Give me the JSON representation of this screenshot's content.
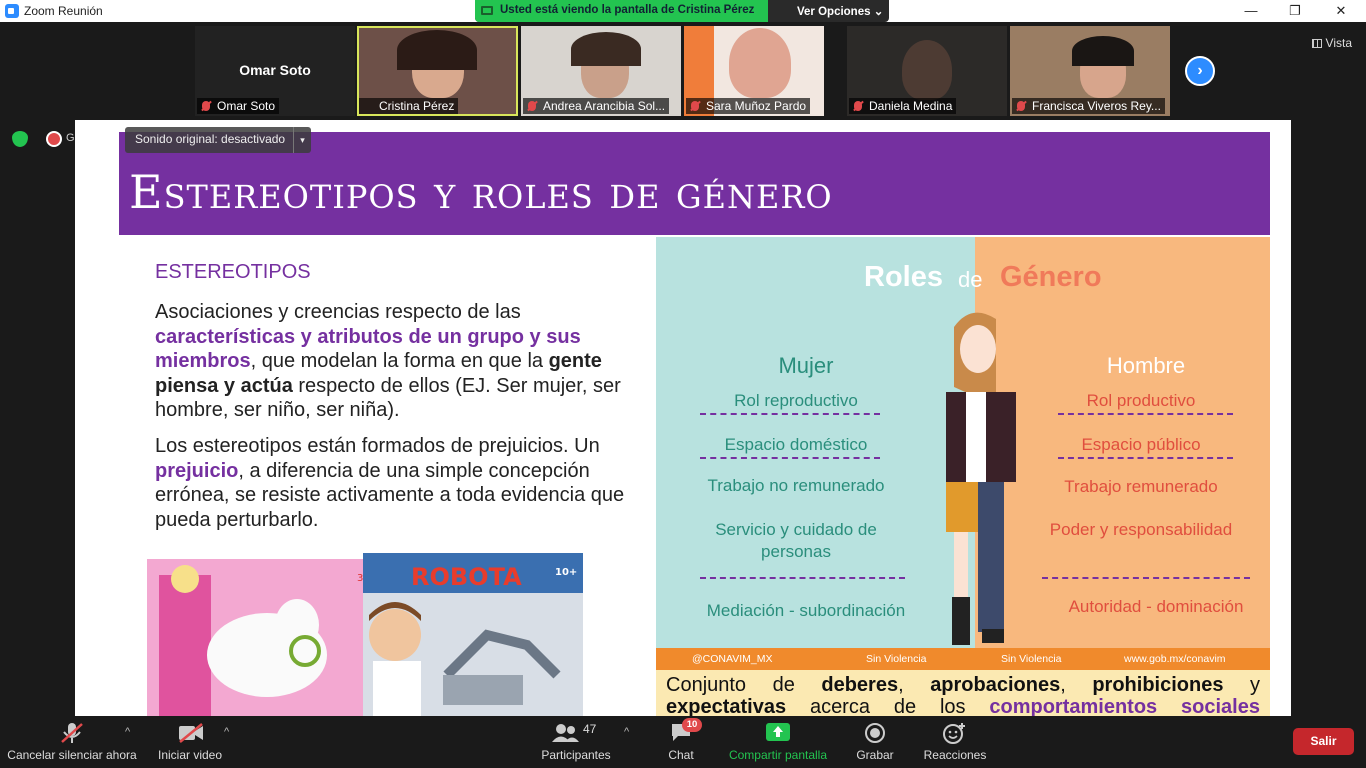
{
  "window": {
    "title": "Zoom Reunión",
    "minimize": "—",
    "maximize": "❐",
    "close": "✕"
  },
  "share_banner": {
    "text": "Usted está viendo la pantalla de Cristina Pérez",
    "options": "Ver Opciones ⌄"
  },
  "view": {
    "label": "Vista"
  },
  "participants": [
    {
      "name": "Omar Soto",
      "big": "Omar Soto"
    },
    {
      "name": "Cristina Pérez"
    },
    {
      "name": "Andrea Arancibia Sol..."
    },
    {
      "name": "Sara Muñoz Pardo"
    },
    {
      "name": "Daniela Medina"
    },
    {
      "name": "Francisca Viveros Rey..."
    }
  ],
  "audio": {
    "original_sound": "Sonido original: desactivado",
    "drop": "▾"
  },
  "recording": {
    "label": "G"
  },
  "slide": {
    "title": "Estereotipos y roles de género",
    "section": "ESTEREOTIPOS",
    "p1": {
      "a": "Asociaciones y creencias respecto de las ",
      "b": "características y atributos de un grupo y sus miembros",
      "c": ", que modelan la forma en que la ",
      "d": "gente piensa y actúa",
      "e": " respecto de ellos (EJ. Ser mujer, ser hombre, ser niño, ser niña)."
    },
    "p2": {
      "a": "Los estereotipos están formados de prejuicios. Un ",
      "b": "prejuicio",
      "c": ", a diferencia de una simple concepción errónea, se resiste activamente a toda evidencia que pueda perturbarlo."
    },
    "toys": {
      "robot_brand": "ROBOTA",
      "age": "10+",
      "age_small": "3"
    },
    "roles": {
      "title_a": "Roles",
      "title_b": "de",
      "title_c": "Género",
      "mujer": "Mujer",
      "hombre": "Hombre",
      "mujer_items": [
        "Rol reproductivo",
        "Espacio doméstico",
        "Trabajo no remunerado",
        "Servicio y cuidado de personas",
        "Mediación - subordinación"
      ],
      "hombre_items": [
        "Rol productivo",
        "Espacio público",
        "Trabajo remunerado",
        "Poder y responsabilidad",
        "Autoridad - dominación"
      ]
    },
    "footer": {
      "conavim": "@CONAVIM_MX",
      "fb": "Sin Violencia",
      "ig": "Sin Violencia",
      "web": "www.gob.mx/conavim"
    },
    "conjunto": {
      "l1a": "Conjunto de ",
      "l1b": "deberes",
      "l1c": ", ",
      "l1d": "aprobaciones",
      "l1e": ", ",
      "l1f": "prohibiciones",
      "l1g": " y",
      "l2a": "expectativas",
      "l2b": " acerca de los ",
      "l2c": "comportamientos sociales"
    }
  },
  "toolbar": {
    "mute": "Cancelar silenciar ahora",
    "video": "Iniciar video",
    "participants": "Participantes",
    "participants_count": "47",
    "chat": "Chat",
    "chat_badge": "10",
    "share": "Compartir pantalla",
    "record": "Grabar",
    "reactions": "Reacciones",
    "leave": "Salir",
    "caret": "^"
  },
  "colors": {
    "purple": "#7530a0",
    "teal": "#b8e2df",
    "orange": "#f8b87e",
    "zoom_blue": "#2d8cff",
    "share_green": "#23c450",
    "leave_red": "#c5272c"
  }
}
